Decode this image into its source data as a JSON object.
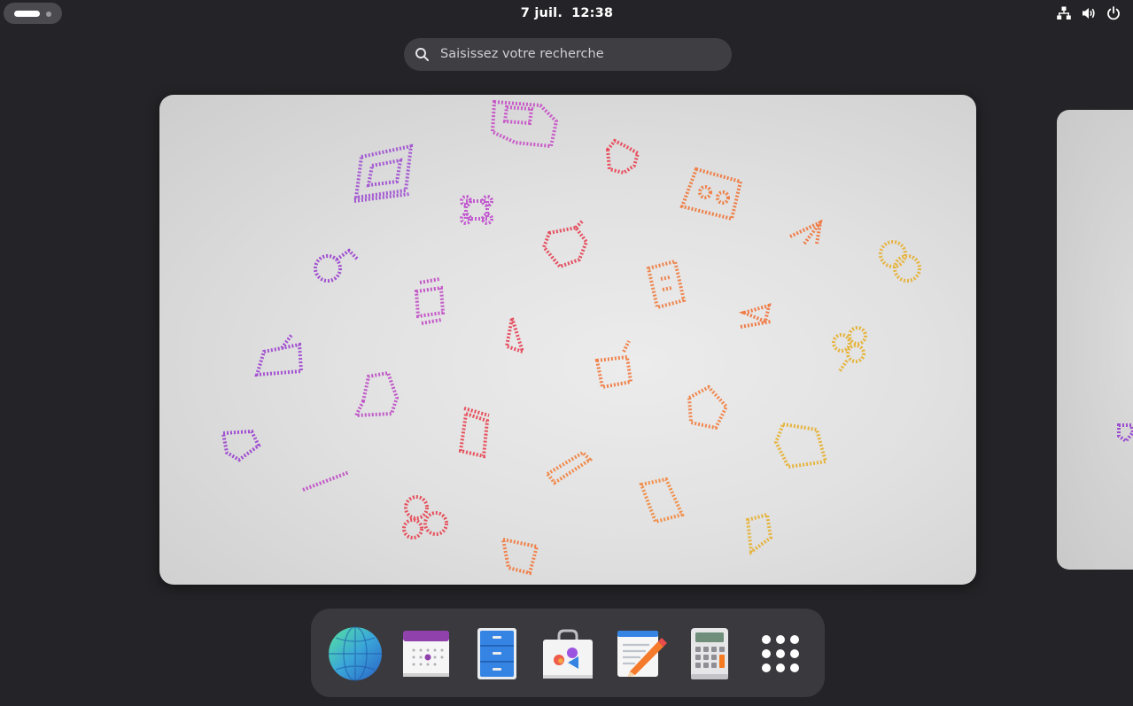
{
  "topbar": {
    "date": "7 juil.",
    "time": "12:38",
    "icons": [
      "network-icon",
      "volume-icon",
      "power-icon"
    ]
  },
  "search": {
    "placeholder": "Saisissez votre recherche"
  },
  "workspace": {
    "wallpaper": "pixel-art icons",
    "icon_colors": [
      "#a24fd0",
      "#d65aa3",
      "#ee5a6b",
      "#f0854a",
      "#e6b43a"
    ]
  },
  "dock": {
    "apps": [
      {
        "name": "Web",
        "icon": "globe-icon"
      },
      {
        "name": "Agenda",
        "icon": "calendar-icon"
      },
      {
        "name": "Fichiers",
        "icon": "file-cabinet-icon"
      },
      {
        "name": "Logiciels",
        "icon": "software-bag-icon"
      },
      {
        "name": "Éditeur de texte",
        "icon": "text-editor-icon"
      },
      {
        "name": "Calculatrice",
        "icon": "calculator-icon"
      },
      {
        "name": "Afficher les applications",
        "icon": "app-grid-icon"
      }
    ]
  },
  "colors": {
    "background": "#242428",
    "panel": "#3a3a3e",
    "search_bg": "#3e3e43"
  }
}
